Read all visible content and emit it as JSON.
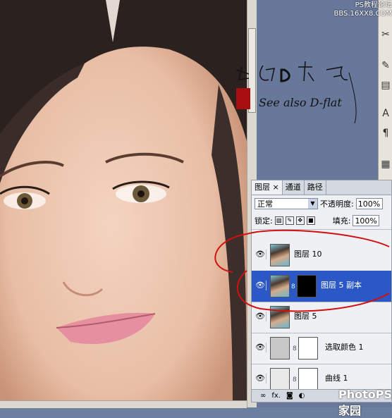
{
  "watermark": {
    "line1": "PS教程论坛",
    "line2": "BBS.16XX8.COM"
  },
  "annotation": {
    "script": "See also D-flat"
  },
  "tabs": [
    {
      "label": "图层",
      "close": "×"
    },
    {
      "label": "通道"
    },
    {
      "label": "路径"
    }
  ],
  "blend": {
    "mode": "正常",
    "opacity_label": "不透明度:",
    "opacity": "100%"
  },
  "lock": {
    "label": "锁定:",
    "fill_label": "填充:",
    "fill": "100%"
  },
  "layers": [
    {
      "name": "图层 10"
    },
    {
      "name": "图层 5 副本"
    },
    {
      "name": "图层 5"
    },
    {
      "name": "选取颜色 1"
    },
    {
      "name": "曲线 1"
    }
  ],
  "footer": {
    "fx": "fx."
  },
  "logo": "PhotoPS 家园",
  "colors": {
    "selection": "#2b58c6",
    "annotation_red": "#d01010"
  }
}
